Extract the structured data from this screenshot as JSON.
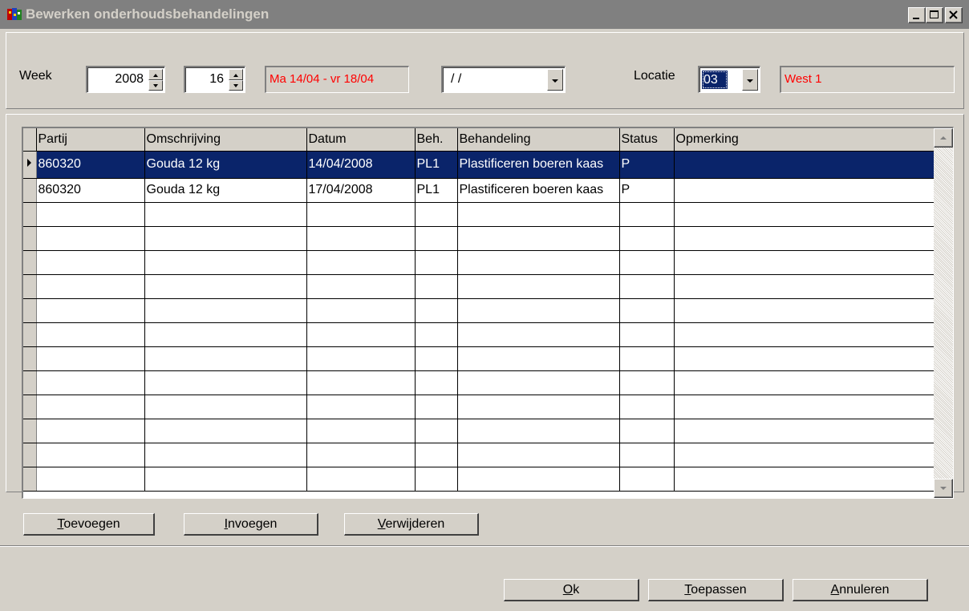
{
  "window": {
    "title": "Bewerken onderhoudsbehandelingen",
    "controls": [
      "minimize",
      "maximize",
      "close"
    ]
  },
  "filters": {
    "week_label": "Week",
    "year_value": "2008",
    "week_value": "16",
    "date_range": "Ma 14/04 - vr 18/04",
    "date_select_value": "/ /",
    "locatie_label": "Locatie",
    "locatie_value": "03",
    "locatie_name": "West 1"
  },
  "grid": {
    "columns": [
      "Partij",
      "Omschrijving",
      "Datum",
      "Beh.",
      "Behandeling",
      "Status",
      "Opmerking"
    ],
    "rows": [
      {
        "partij": "860320",
        "omschrijving": "Gouda 12 kg",
        "datum": "14/04/2008",
        "beh": "PL1",
        "behandeling": "Plastificeren boeren kaas",
        "status": "P",
        "opmerking": "",
        "selected": true
      },
      {
        "partij": "860320",
        "omschrijving": "Gouda 12 kg",
        "datum": "17/04/2008",
        "beh": "PL1",
        "behandeling": "Plastificeren boeren kaas",
        "status": "P",
        "opmerking": "",
        "selected": false
      }
    ],
    "empty_rows": 12
  },
  "row_buttons": {
    "add": {
      "first": "T",
      "rest": "oevoegen"
    },
    "insert": {
      "first": "I",
      "rest": "nvoegen"
    },
    "delete": {
      "first": "V",
      "rest": "erwijderen"
    }
  },
  "dialog_buttons": {
    "ok": {
      "first": "O",
      "rest": "k"
    },
    "apply": {
      "first": "T",
      "rest": "oepassen"
    },
    "cancel": {
      "first": "A",
      "rest": "nnuleren"
    }
  },
  "colors": {
    "face": "#d4d0c8",
    "title_inactive": "#808080",
    "selection": "#0a246a",
    "red_text": "#ff0000"
  }
}
